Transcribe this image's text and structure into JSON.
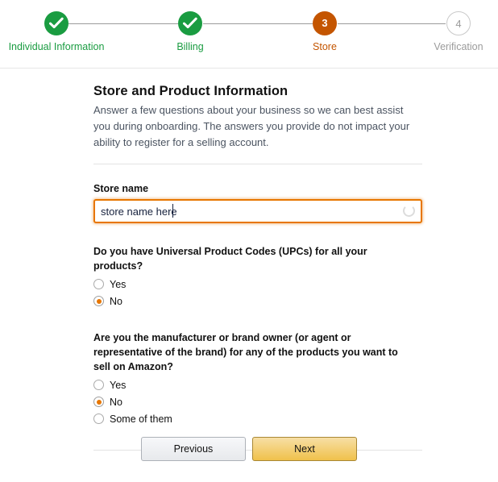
{
  "tracker": {
    "steps": [
      {
        "label": "Individual Information",
        "state": "done",
        "number": "1",
        "icon": "check-icon"
      },
      {
        "label": "Billing",
        "state": "done",
        "number": "2",
        "icon": "check-icon"
      },
      {
        "label": "Store",
        "state": "current",
        "number": "3",
        "icon": ""
      },
      {
        "label": "Verification",
        "state": "todo",
        "number": "4",
        "icon": ""
      }
    ],
    "colors": {
      "done": "#1A9C41",
      "current": "#C45500",
      "todo": "#9B9B9B",
      "line": "#9B9B9B"
    }
  },
  "panel": {
    "title": "Store and Product Information",
    "description": "Answer a few questions about your business so we can best assist you during onboarding. The answers you provide do not impact your ability to register for a selling account."
  },
  "store_name": {
    "label": "Store name",
    "value": "store name here",
    "placeholder": "",
    "spinner_icon": "loading-spinner-icon",
    "focus_color": "#E77600"
  },
  "questions": [
    {
      "text": "Do you have Universal Product Codes (UPCs) for all your products?",
      "options": [
        {
          "label": "Yes",
          "checked": false
        },
        {
          "label": "No",
          "checked": true
        }
      ]
    },
    {
      "text": "Are you the manufacturer or brand owner (or agent or representative of the brand) for any of the products you want to sell on Amazon?",
      "options": [
        {
          "label": "Yes",
          "checked": false
        },
        {
          "label": "No",
          "checked": true
        },
        {
          "label": "Some of them",
          "checked": false
        }
      ]
    }
  ],
  "footer": {
    "previous_label": "Previous",
    "next_label": "Next",
    "next_color": "#F0C14B"
  }
}
